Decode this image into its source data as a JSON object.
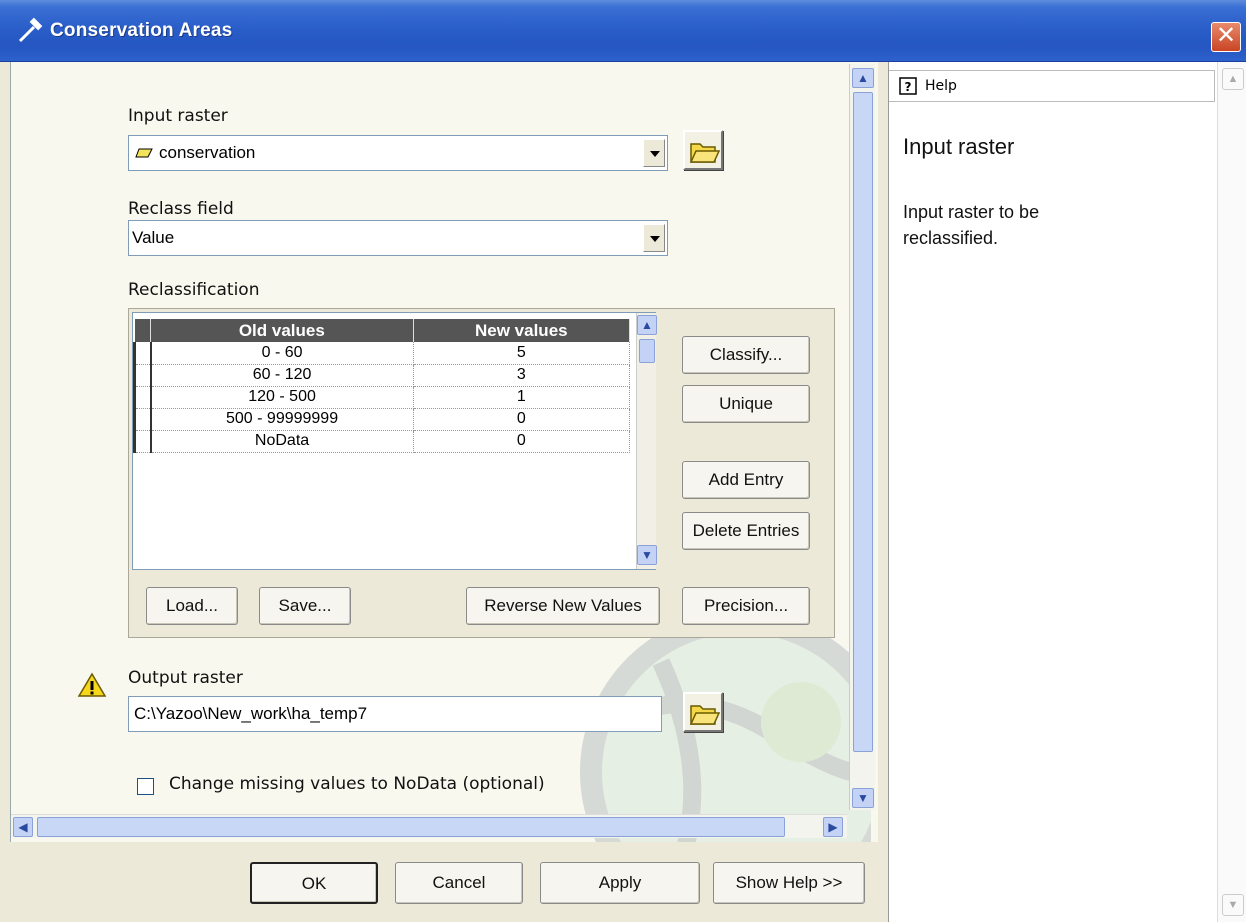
{
  "window": {
    "title": "Conservation Areas",
    "close_symbol": "✕"
  },
  "form": {
    "input_raster": {
      "label": "Input raster",
      "value": "conservation"
    },
    "reclass_field": {
      "label": "Reclass field",
      "value": "Value"
    },
    "reclassification": {
      "label": "Reclassification",
      "columns": [
        "Old values",
        "New values"
      ],
      "rows": [
        {
          "old": "0 - 60",
          "new": "5"
        },
        {
          "old": "60 - 120",
          "new": "3"
        },
        {
          "old": "120 - 500",
          "new": "1"
        },
        {
          "old": "500 - 99999999",
          "new": "0"
        },
        {
          "old": "NoData",
          "new": "0"
        }
      ],
      "buttons": {
        "classify": "Classify...",
        "unique": "Unique",
        "add_entry": "Add Entry",
        "delete_entries": "Delete Entries",
        "load": "Load...",
        "save": "Save...",
        "reverse": "Reverse New Values",
        "precision": "Precision..."
      }
    },
    "output_raster": {
      "label": "Output raster",
      "value": "C:\\Yazoo\\New_work\\ha_temp7"
    },
    "missing_values": {
      "label": "Change missing values to NoData (optional)",
      "checked": false
    }
  },
  "footer": {
    "ok": "OK",
    "cancel": "Cancel",
    "apply": "Apply",
    "show_help": "Show Help >>"
  },
  "help": {
    "tab_label": "Help",
    "heading": "Input raster",
    "body_line1": "Input raster to be",
    "body_line2": "reclassified."
  },
  "icons": [
    "hammer-icon",
    "close-icon",
    "raster-layer-icon",
    "open-folder-icon",
    "warning-icon",
    "help-question-icon"
  ]
}
